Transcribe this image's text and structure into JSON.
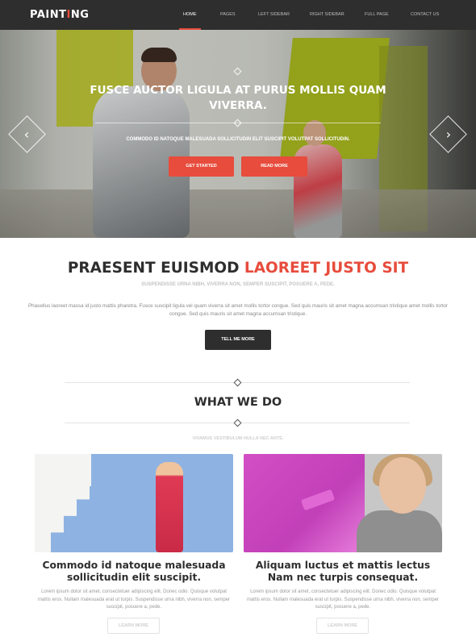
{
  "header": {
    "logo_pre": "PAINT",
    "logo_accent": "I",
    "logo_post": "NG",
    "nav": [
      "HOME",
      "PAGES",
      "LEFT SIDEBAR",
      "RIGHT SIDEBAR",
      "FULL PAGE",
      "CONTACT US"
    ],
    "active_nav": "HOME"
  },
  "hero": {
    "title": "FUSCE AUCTOR LIGULA AT PURUS MOLLIS QUAM VIVERRA.",
    "subtitle": "COMMODO ID NATOQUE MALESUADA SOLLICITUDIN ELIT SUSCIPIT VOLUTPAT SOLLICITUDIN.",
    "btn_primary": "GET STARTED",
    "btn_secondary": "READ MORE",
    "prev_arrow": "‹",
    "next_arrow": "›"
  },
  "intro": {
    "title_dark": "PRAESENT EUISMOD ",
    "title_red": "LAOREET JUSTO SIT",
    "subtitle": "SUSPENDISSE URNA NIBH, VIVERRA NON, SEMPER SUSCIPIT, POSUERE A, PEDE.",
    "text": "Phasellus laoreet massa id justo mattis pharetra. Fusce suscipit ligula vel quam viverra sit amet mollis tortor congue. Sed quis mauris sit amet magna accumsan tristique amet mollis tortor congue. Sed quis mauris sit amet magna accumsan tristique.",
    "button": "TELL ME MORE"
  },
  "what_we_do": {
    "title": "WHAT WE DO",
    "subtitle": "VIVAMUS VESTIBULUM NULLA NEC ANTE."
  },
  "cards": [
    {
      "title": "Commodo id natoque malesuada sollicitudin elit suscipit.",
      "text": "Lorem ipsum dolor sit amet, consectetuer adipiscing elit. Donec odio. Quisque volutpat mattis eros. Nullam malesuada erat ut turpis. Suspendisse urna nibh, viverra non, semper suscipit, posuere a, pede.",
      "button": "LEARN MORE"
    },
    {
      "title": "Aliquam luctus et mattis lectus Nam nec turpis consequat.",
      "text": "Lorem ipsum dolor sit amet, consectetuer adipiscing elit. Donec odio. Quisque volutpat mattis eros. Nullam malesuada erat ut turpis. Suspendisse urna nibh, viverra non, semper suscipit, posuere a, pede.",
      "button": "LEARN MORE"
    }
  ],
  "colors": {
    "accent": "#e74c3c",
    "dark": "#2e2e2e"
  }
}
